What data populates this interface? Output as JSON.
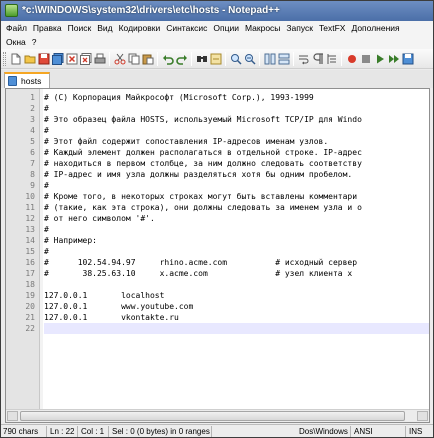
{
  "window": {
    "title": "*c:\\WINDOWS\\system32\\drivers\\etc\\hosts - Notepad++"
  },
  "menu": {
    "row1": [
      "Файл",
      "Правка",
      "Поиск",
      "Вид",
      "Кодировки",
      "Синтаксис",
      "Опции",
      "Макросы",
      "Запуск",
      "TextFX",
      "Дополнения"
    ],
    "row2": [
      "Окна",
      "?"
    ]
  },
  "toolbar": {
    "icons": [
      "new-file-icon",
      "open-file-icon",
      "save-icon",
      "save-all-icon",
      "close-icon",
      "close-all-icon",
      "print-icon",
      "cut-icon",
      "copy-icon",
      "paste-icon",
      "undo-icon",
      "redo-icon",
      "find-icon",
      "replace-icon",
      "zoom-in-icon",
      "zoom-out-icon",
      "sync-v-icon",
      "sync-h-icon",
      "wrap-icon",
      "all-chars-icon",
      "indent-guide-icon",
      "record-macro-icon",
      "stop-macro-icon",
      "play-macro-icon",
      "run-macro-multi-icon",
      "save-macro-icon"
    ]
  },
  "tabs": [
    {
      "label": "hosts"
    }
  ],
  "editor": {
    "current_line": 22,
    "lines": [
      "# (C) Корпорация Майкрософт (Microsoft Corp.), 1993-1999",
      "#",
      "# Это образец файла HOSTS, используемый Microsoft TCP/IP для Windo",
      "#",
      "# Этот файл содержит сопоставления IP-адресов именам узлов.",
      "# Каждый элемент должен располагаться в отдельной строке. IP-адрес",
      "# находиться в первом столбце, за ним должно следовать соответству",
      "# IP-адрес и имя узла должны разделяться хотя бы одним пробелом.",
      "#",
      "# Кроме того, в некоторых строках могут быть вставлены комментари",
      "# (такие, как эта строка), они должны следовать за именем узла и о",
      "# от него символом '#'.",
      "#",
      "# Например:",
      "#",
      "#      102.54.94.97     rhino.acme.com          # исходный сервер",
      "#       38.25.63.10     x.acme.com              # узел клиента x",
      "",
      "127.0.0.1       localhost",
      "127.0.0.1       www.youtube.com",
      "127.0.0.1       vkontakte.ru",
      ""
    ]
  },
  "status": {
    "chars": "790 chars",
    "ln": "Ln : 22",
    "col": "Col : 1",
    "sel": "Sel : 0 (0 bytes) in 0 ranges",
    "eol": "Dos\\Windows",
    "encoding": "ANSI",
    "mode": "INS"
  }
}
